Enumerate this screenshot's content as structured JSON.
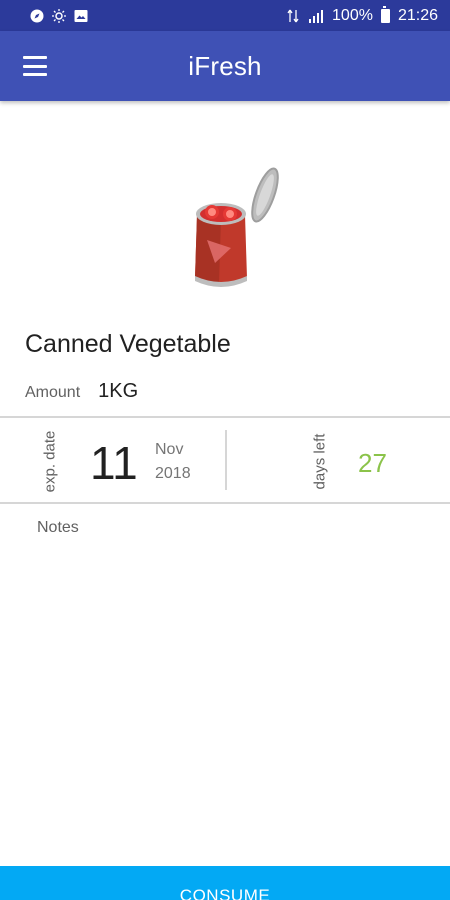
{
  "status_bar": {
    "battery": "100%",
    "time": "21:26"
  },
  "app_bar": {
    "title": "iFresh",
    "menu_icon": "hamburger-menu-icon"
  },
  "product": {
    "image_icon": "canned-tomato-icon",
    "name": "Canned Vegetable",
    "amount_label": "Amount",
    "amount_value": "1KG"
  },
  "expiry": {
    "label": "exp. date",
    "day": "11",
    "month": "Nov",
    "year": "2018"
  },
  "days_left": {
    "label": "days left",
    "value": "27",
    "color": "#8bc34a"
  },
  "notes": {
    "label": "Notes"
  },
  "actions": {
    "consume_label": "CONSUME"
  },
  "colors": {
    "status_bar": "#2c3a9b",
    "app_bar": "#3f51b5",
    "consume_button": "#03a9f4"
  }
}
